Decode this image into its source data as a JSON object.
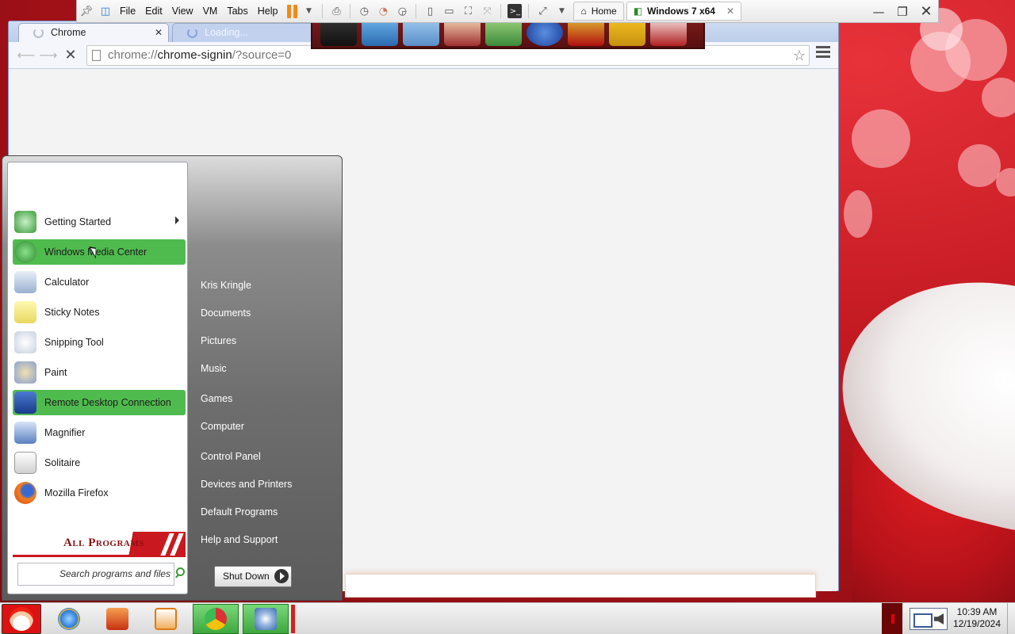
{
  "vm_toolbar": {
    "menus": [
      "File",
      "Edit",
      "View",
      "VM",
      "Tabs",
      "Help"
    ],
    "tabs": [
      {
        "label": "Home",
        "icon": "home-icon"
      },
      {
        "label": "Windows 7 x64",
        "icon": "vm-icon"
      }
    ]
  },
  "browser": {
    "tabs": [
      {
        "label": "Chrome"
      },
      {
        "label": "Loading..."
      }
    ],
    "url": {
      "scheme": "chrome://",
      "host": "chrome-signin",
      "path": "/?source=0"
    }
  },
  "start_menu": {
    "programs": [
      {
        "label": "Getting Started",
        "icon": "getting-started-icon",
        "has_submenu": true
      },
      {
        "label": "Windows Media Center",
        "icon": "media-center-icon",
        "highlighted": true
      },
      {
        "label": "Calculator",
        "icon": "calculator-icon"
      },
      {
        "label": "Sticky Notes",
        "icon": "sticky-notes-icon"
      },
      {
        "label": "Snipping Tool",
        "icon": "snipping-tool-icon"
      },
      {
        "label": "Paint",
        "icon": "paint-icon"
      },
      {
        "label": "Remote Desktop Connection",
        "icon": "remote-desktop-icon",
        "highlighted": true
      },
      {
        "label": "Magnifier",
        "icon": "magnifier-icon"
      },
      {
        "label": "Solitaire",
        "icon": "solitaire-icon"
      },
      {
        "label": "Mozilla Firefox",
        "icon": "firefox-icon"
      }
    ],
    "all_programs": "All Programs",
    "search_placeholder": "Search programs and files",
    "right_items": [
      "Kris Kringle",
      "Documents",
      "Pictures",
      "Music",
      "Games",
      "Computer",
      "Control Panel",
      "Devices and Printers",
      "Default Programs",
      "Help and Support"
    ],
    "shutdown_label": "Shut Down"
  },
  "taskbar": {
    "time": "10:39 AM",
    "date": "12/19/2024"
  },
  "colors": {
    "highlight": "#4fbb4f",
    "wallpaper": "#c41a22",
    "start_accent": "#c9181f"
  }
}
